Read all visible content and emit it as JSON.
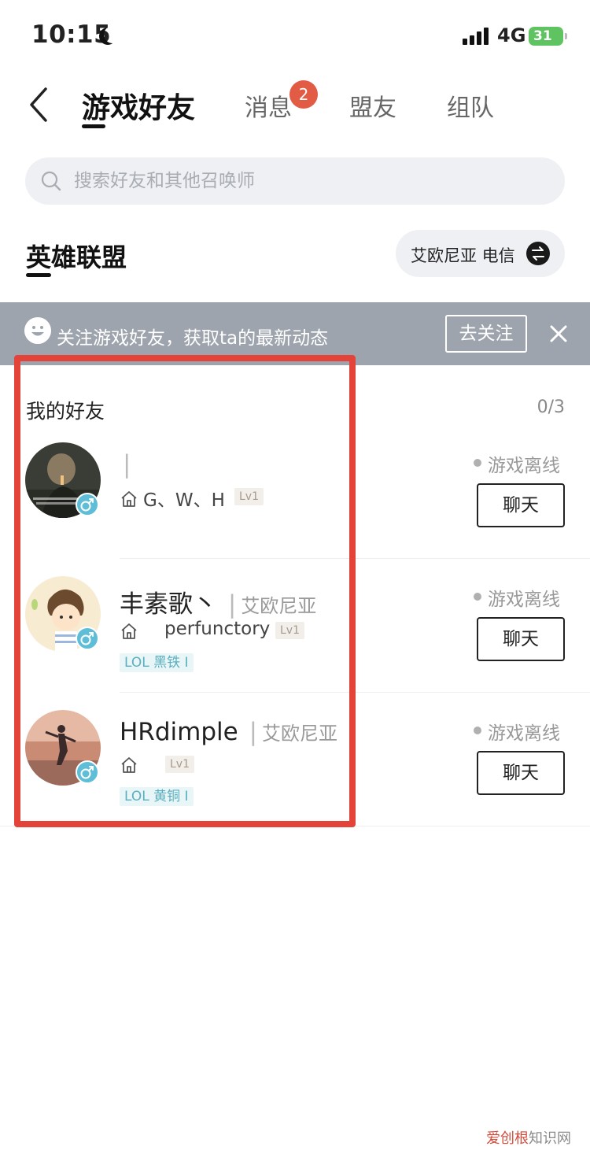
{
  "status_bar": {
    "time": "10:15",
    "network": "4G",
    "battery": "31"
  },
  "header": {
    "tabs": [
      {
        "label": "游戏好友",
        "active": true
      },
      {
        "label": "消息",
        "badge": "2"
      },
      {
        "label": "盟友"
      },
      {
        "label": "组队"
      }
    ]
  },
  "search": {
    "placeholder": "搜索好友和其他召唤师"
  },
  "game": {
    "title": "英雄联盟",
    "server": "艾欧尼亚 电信"
  },
  "banner": {
    "text": "关注游戏好友，获取ta的最新动态",
    "button": "去关注"
  },
  "friends": {
    "title": "我的好友",
    "count": "0/3",
    "items": [
      {
        "name": "",
        "server": "",
        "sub": "G、W、H",
        "level": "Lv1",
        "rank": "",
        "status": "游戏离线",
        "chat": "聊天"
      },
      {
        "name": "丰素歌丶",
        "server": "艾欧尼亚",
        "sub": "perfunctory",
        "level": "Lv1",
        "rank": "LOL 黑铁 I",
        "status": "游戏离线",
        "chat": "聊天"
      },
      {
        "name": "HRdimple",
        "server": "艾欧尼亚",
        "sub": "",
        "level": "Lv1",
        "rank": "LOL 黄铜 I",
        "status": "游戏离线",
        "chat": "聊天"
      }
    ]
  },
  "watermark": {
    "brand": "爱创根",
    "suffix": "知识网"
  },
  "colors": {
    "highlight": "#e4433a",
    "badge": "#e25b45",
    "gender": "#5ebed7",
    "banner": "#9ea4ad"
  }
}
